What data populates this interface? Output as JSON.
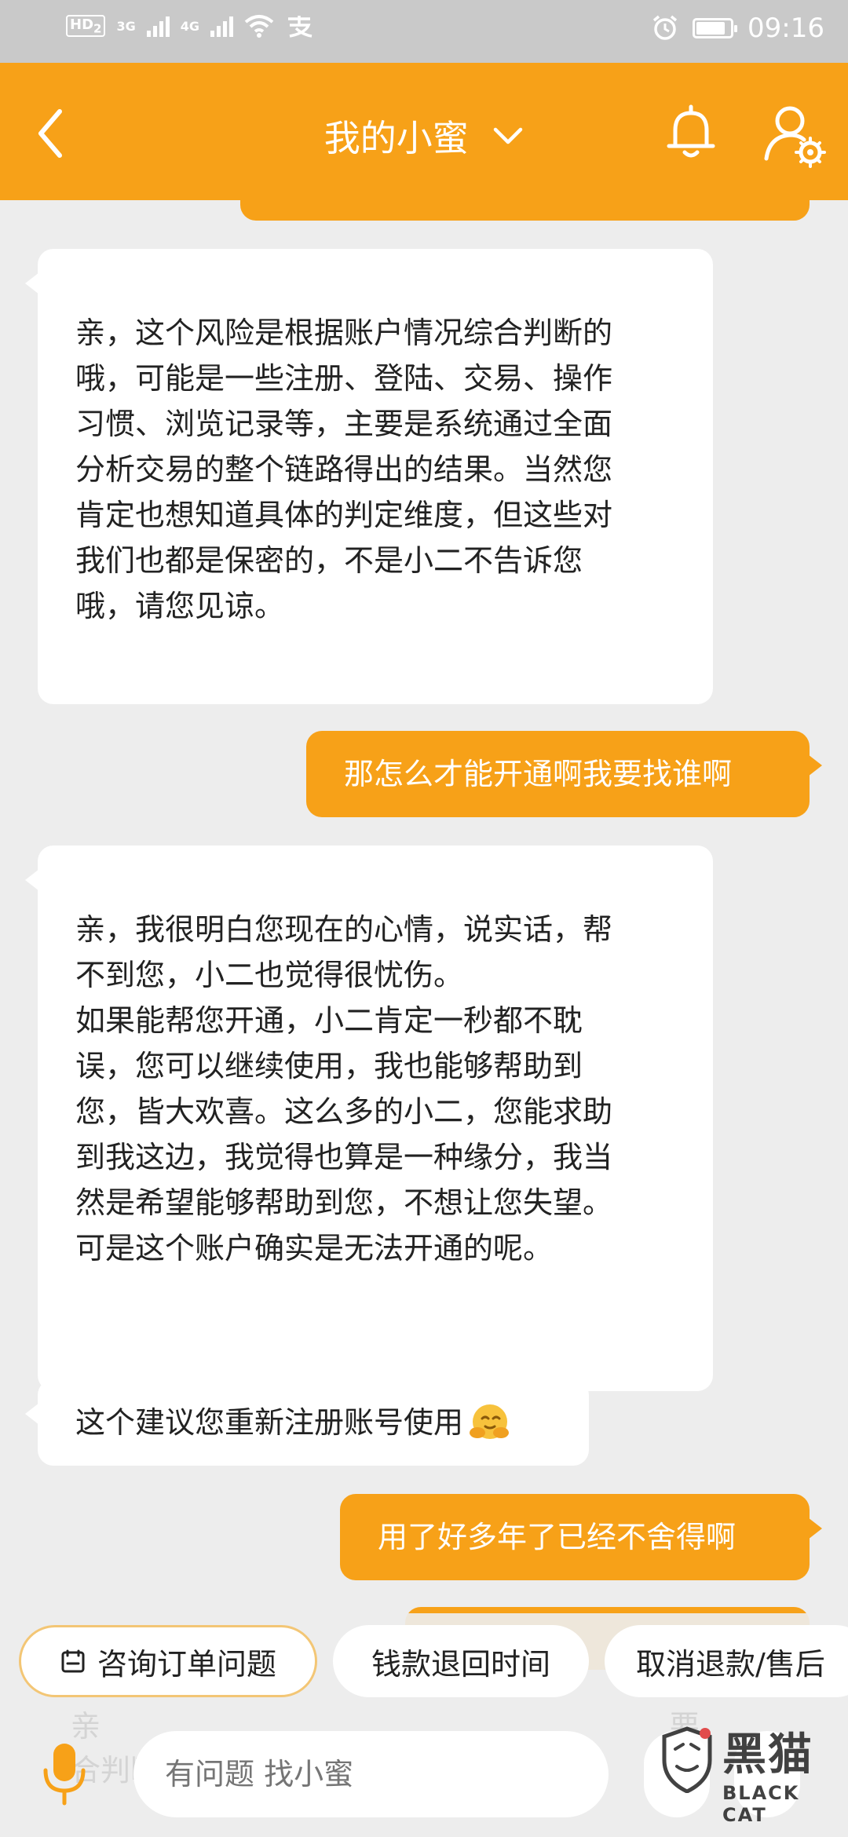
{
  "status_bar": {
    "network_hd": "HD",
    "network_hd_sub": "2",
    "network_3g": "3G",
    "network_4g": "4G",
    "battery_level": 0.85,
    "time": "09:16"
  },
  "header": {
    "title": "我的小蜜",
    "back_icon": "chevron-left-icon",
    "dropdown_icon": "chevron-down-icon",
    "bell_icon": "bell-icon",
    "profile_icon": "user-settings-icon"
  },
  "messages": [
    {
      "from": "agent",
      "text": "亲，这个风险是根据账户情况综合判断的\n哦，可能是一些注册、登陆、交易、操作\n习惯、浏览记录等，主要是系统通过全面\n分析交易的整个链路得出的结果。当然您\n肯定也想知道具体的判定维度，但这些对\n我们也都是保密的，不是小二不告诉您\n哦，请您见谅。"
    },
    {
      "from": "user",
      "text": "那怎么才能开通啊我要找谁啊"
    },
    {
      "from": "agent",
      "text": "亲，我很明白您现在的心情，说实话，帮\n不到您，小二也觉得很忧伤。\n如果能帮您开通，小二肯定一秒都不耽\n误，您可以继续使用，我也能够帮助到\n您，皆大欢喜。这么多的小二，您能求助\n到我这边，我觉得也算是一种缘分，我当\n然是希望能够帮助到您，不想让您失望。\n可是这个账户确实是无法开通的呢。"
    },
    {
      "from": "agent",
      "text": "这个建议您重新注册账号使用",
      "emoji": "hug-emoji-icon"
    },
    {
      "from": "user",
      "text": "用了好多年了已经不舍得啊"
    }
  ],
  "quick_replies": [
    {
      "label": "咨询订单问题",
      "icon": "order-icon"
    },
    {
      "label": "钱款退回时间"
    },
    {
      "label": "取消退款/售后"
    }
  ],
  "input": {
    "placeholder": "有问题 找小蜜",
    "mic_icon": "microphone-icon",
    "ghost_text": "亲                                                            要\n合判断的，但具体的原因小二确实也不知"
  },
  "watermark": {
    "cn": "黑猫",
    "en": "BLACK CAT"
  },
  "colors": {
    "accent": "#f7a118",
    "background": "#ededed",
    "status_bar": "#c9c9c9"
  }
}
